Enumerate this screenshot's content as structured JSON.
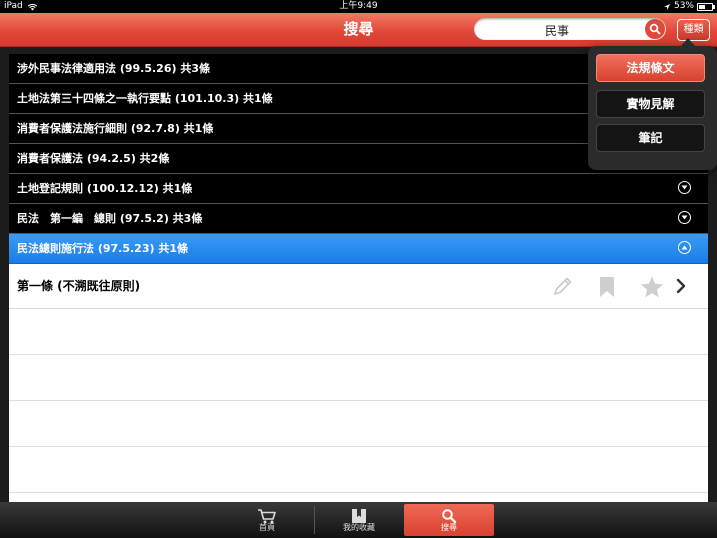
{
  "status_bar": {
    "device": "iPad",
    "time": "上午9:49",
    "battery": "53%",
    "battery_level": 0.53
  },
  "nav": {
    "title": "搜尋",
    "search_value": "民事",
    "category_button": "種類"
  },
  "laws": [
    {
      "label": "涉外民事法律適用法 (99.5.26) 共3條",
      "expanded": false
    },
    {
      "label": "土地法第三十四條之一執行要點 (101.10.3) 共1條",
      "expanded": false
    },
    {
      "label": "消費者保護法施行細則 (92.7.8) 共1條",
      "expanded": false
    },
    {
      "label": "消費者保護法 (94.2.5) 共2條",
      "expanded": false
    },
    {
      "label": "土地登記規則 (100.12.12) 共1條",
      "expanded": false
    },
    {
      "label": "民法　第一編　總則 (97.5.2) 共3條",
      "expanded": false
    },
    {
      "label": "民法總則施行法 (97.5.23) 共1條",
      "expanded": true
    }
  ],
  "article": {
    "label": "第一條 (不溯既往原則)"
  },
  "category_menu": {
    "options": [
      "法規條文",
      "實物見解",
      "筆記"
    ],
    "selected": "法規條文"
  },
  "tabs": [
    {
      "label": "首頁",
      "icon": "cart-icon"
    },
    {
      "label": "我的收藏",
      "icon": "bookmark-icon"
    },
    {
      "label": "搜尋",
      "icon": "search-icon",
      "selected": true
    }
  ],
  "colors": {
    "accent": "#e2483a",
    "active_row": "#1a7de6"
  }
}
